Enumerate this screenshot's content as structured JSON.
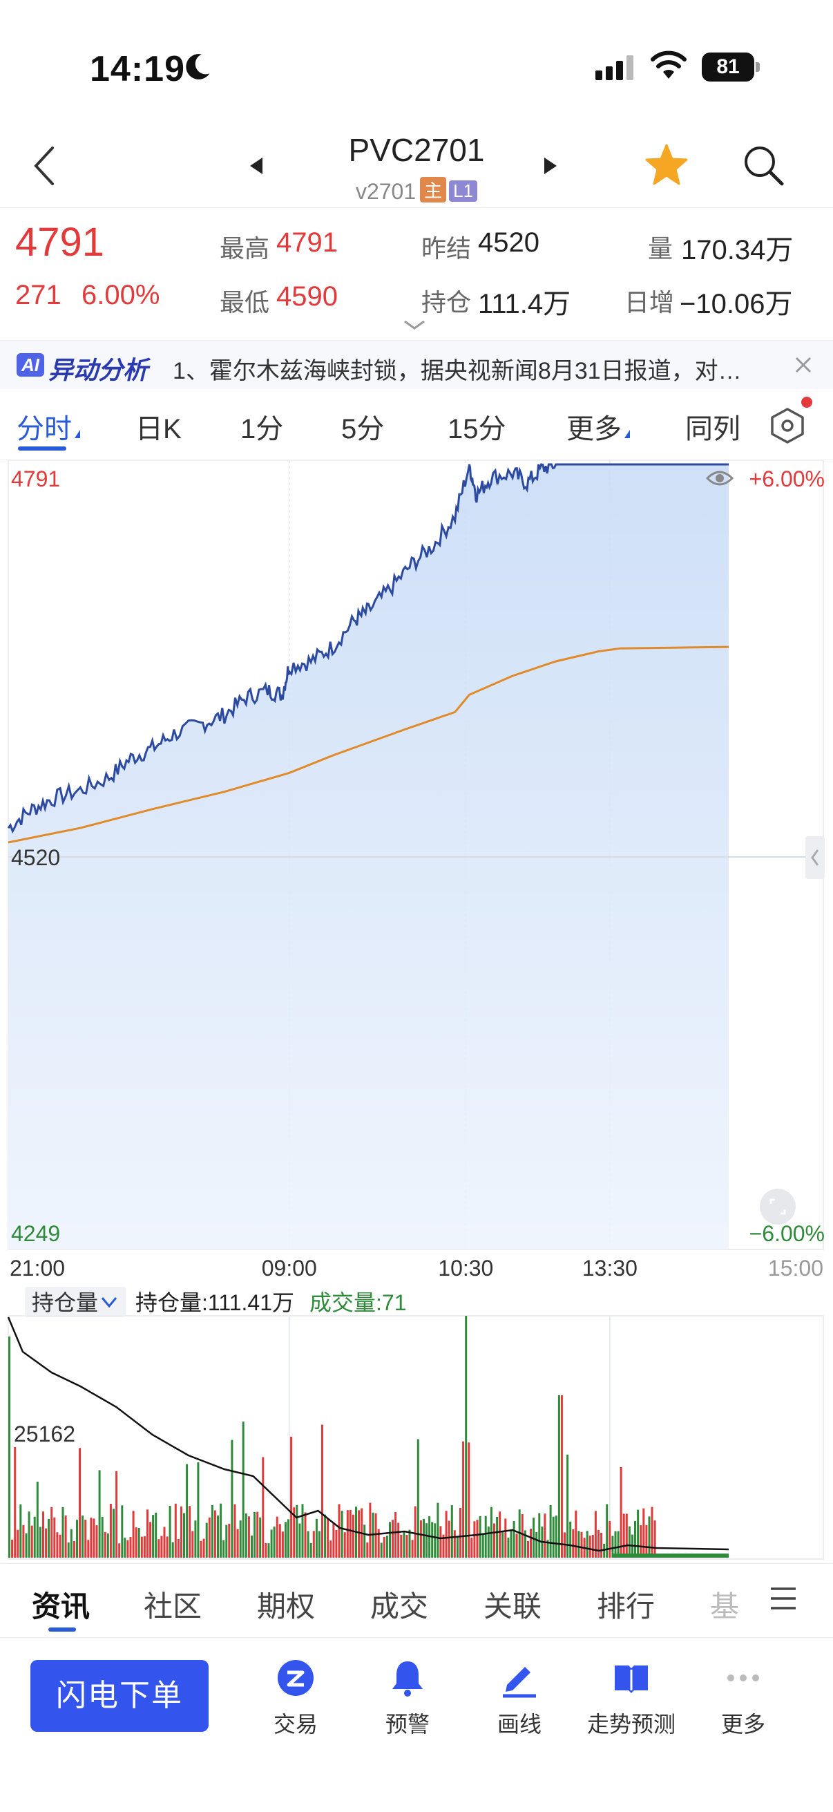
{
  "status_bar": {
    "time": "14:19",
    "battery": "81"
  },
  "header": {
    "title": "PVC2701",
    "subtitle": "v2701",
    "tag_main": "主",
    "tag_level": "L1"
  },
  "quote": {
    "price": "4791",
    "change": "271",
    "change_pct": "6.00%",
    "high_label": "最高",
    "high": "4791",
    "low_label": "最低",
    "low": "4590",
    "prev_settle_label": "昨结",
    "prev_settle": "4520",
    "open_interest_label": "持仓",
    "open_interest": "111.4万",
    "volume_label": "量",
    "volume": "170.34万",
    "daily_increase_label": "日增",
    "daily_increase": "−10.06万"
  },
  "banner": {
    "ai": "AI",
    "title": "异动分析",
    "text": "1、霍尔木兹海峡封锁，据央视新闻8月31日报道，对…"
  },
  "tabs": [
    {
      "label": "分时"
    },
    {
      "label": "日K"
    },
    {
      "label": "1分"
    },
    {
      "label": "5分"
    },
    {
      "label": "15分"
    },
    {
      "label": "更多"
    },
    {
      "label": "同列"
    }
  ],
  "chart_labels": {
    "top": "4791",
    "mid": "4520",
    "bottom": "4249",
    "pct_top": "+6.00%",
    "pct_bottom": "−6.00%",
    "vol_ref": "25162"
  },
  "indicator": {
    "selector": "持仓量",
    "oi_text": "持仓量:111.41万",
    "vol_text": "成交量:71"
  },
  "colors": {
    "up": "#e23a3a",
    "down": "#2e8b3a",
    "price_line": "#2c4aa0",
    "avg_line": "#e08a2a",
    "accent": "#2a5bd7"
  },
  "chart_data": {
    "type": "line",
    "x_ticks": [
      "21:00",
      "09:00",
      "10:30",
      "13:30",
      "15:00"
    ],
    "ylim": [
      4249,
      4791
    ],
    "pct_range": [
      "-6.00%",
      "+6.00%"
    ],
    "reference": 4520,
    "series": [
      {
        "x": [
          0,
          0.03,
          0.06,
          0.1,
          0.14,
          0.17,
          0.2,
          0.23,
          0.27,
          0.3,
          0.33,
          0.36,
          0.38,
          0.39,
          0.42,
          0.45,
          0.48,
          0.5,
          0.53,
          0.56,
          0.59,
          0.62,
          0.64,
          0.65,
          0.67,
          0.7,
          0.72,
          0.74,
          0.76,
          0.8,
          0.84,
          0.9,
          1.0
        ],
        "values": [
          4540,
          4552,
          4560,
          4566,
          4575,
          4588,
          4595,
          4605,
          4612,
          4618,
          4630,
          4635,
          4632,
          4652,
          4655,
          4665,
          4683,
          4690,
          4705,
          4722,
          4735,
          4755,
          4790,
          4770,
          4782,
          4785,
          4778,
          4788,
          4791,
          4791,
          4791,
          4791,
          4791
        ]
      },
      {
        "x": [
          0,
          0.1,
          0.2,
          0.3,
          0.39,
          0.45,
          0.55,
          0.62,
          0.64,
          0.7,
          0.76,
          0.82,
          0.85,
          1.0
        ],
        "values": [
          4530,
          4540,
          4553,
          4565,
          4578,
          4590,
          4608,
          4620,
          4632,
          4645,
          4655,
          4662,
          4664,
          4665
        ]
      }
    ]
  }
}
